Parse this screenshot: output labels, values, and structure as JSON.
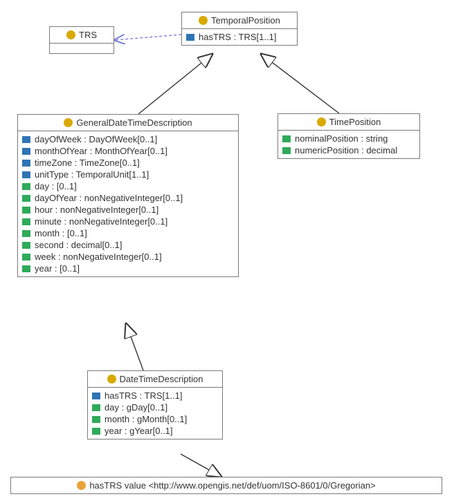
{
  "classes": {
    "trs": {
      "name": "TRS"
    },
    "temporalPosition": {
      "name": "TemporalPosition",
      "attrs": [
        {
          "icon": "blue",
          "text": "hasTRS : TRS[1..1]"
        }
      ]
    },
    "timePosition": {
      "name": "TimePosition",
      "attrs": [
        {
          "icon": "green",
          "text": "nominalPosition : string"
        },
        {
          "icon": "green",
          "text": "numericPosition : decimal"
        }
      ]
    },
    "generalDateTimeDescription": {
      "name": "GeneralDateTimeDescription",
      "attrs": [
        {
          "icon": "blue",
          "text": "dayOfWeek : DayOfWeek[0..1]"
        },
        {
          "icon": "blue",
          "text": "monthOfYear : MonthOfYear[0..1]"
        },
        {
          "icon": "blue",
          "text": "timeZone : TimeZone[0..1]"
        },
        {
          "icon": "blue",
          "text": "unitType : TemporalUnit[1..1]"
        },
        {
          "icon": "green",
          "text": "day : [0..1]"
        },
        {
          "icon": "green",
          "text": "dayOfYear : nonNegativeInteger[0..1]"
        },
        {
          "icon": "green",
          "text": "hour : nonNegativeInteger[0..1]"
        },
        {
          "icon": "green",
          "text": "minute : nonNegativeInteger[0..1]"
        },
        {
          "icon": "green",
          "text": "month : [0..1]"
        },
        {
          "icon": "green",
          "text": "second : decimal[0..1]"
        },
        {
          "icon": "green",
          "text": "week : nonNegativeInteger[0..1]"
        },
        {
          "icon": "green",
          "text": "year : [0..1]"
        }
      ]
    },
    "dateTimeDescription": {
      "name": "DateTimeDescription",
      "attrs": [
        {
          "icon": "blue",
          "text": "hasTRS : TRS[1..1]"
        },
        {
          "icon": "green",
          "text": "day : gDay[0..1]"
        },
        {
          "icon": "green",
          "text": "month : gMonth[0..1]"
        },
        {
          "icon": "green",
          "text": "year : gYear[0..1]"
        }
      ]
    }
  },
  "restriction": {
    "text": "hasTRS value <http://www.opengis.net/def/uom/ISO-8601/0/Gregorian>"
  }
}
